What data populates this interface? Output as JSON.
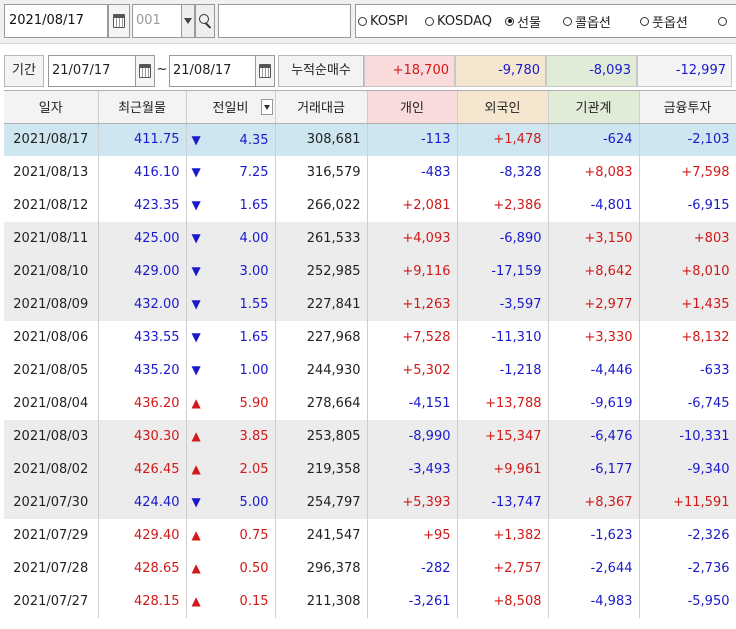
{
  "toolbar": {
    "date": "2021/08/17",
    "code": "001",
    "name": "",
    "markets": [
      {
        "label": "KOSPI",
        "selected": false
      },
      {
        "label": "KOSDAQ",
        "selected": false
      },
      {
        "label": "선물",
        "selected": true
      },
      {
        "label": "콜옵션",
        "selected": false
      },
      {
        "label": "풋옵션",
        "selected": false
      },
      {
        "label": "",
        "selected": false
      }
    ]
  },
  "period": {
    "label": "기간",
    "from": "21/07/17",
    "tilde": "~",
    "to": "21/08/17",
    "cum_label": "누적순매수",
    "cum_values": [
      {
        "key": "individual",
        "value": "+18,700",
        "color": "#d11919",
        "bg": "#fadbdb"
      },
      {
        "key": "foreign",
        "value": "-9,780",
        "color": "#1a1acc",
        "bg": "#f5e6d0"
      },
      {
        "key": "institution",
        "value": "-8,093",
        "color": "#1a1acc",
        "bg": "#e1ecd6"
      },
      {
        "key": "financial",
        "value": "-12,997",
        "color": "#1a1acc",
        "bg": "#f3f3f3"
      }
    ]
  },
  "table": {
    "headers": {
      "date": "일자",
      "recent": "최근월물",
      "change": "전일비",
      "volume": "거래대금",
      "individual": "개인",
      "foreign": "외국인",
      "institution": "기관계",
      "financial": "금융투자"
    },
    "rows": [
      {
        "date": "2021/08/17",
        "price": "411.75",
        "dir": "down",
        "chg": "4.35",
        "vol": "308,681",
        "ind": "-113",
        "for": "+1,478",
        "inst": "-624",
        "fin": "-2,103"
      },
      {
        "date": "2021/08/13",
        "price": "416.10",
        "dir": "down",
        "chg": "7.25",
        "vol": "316,579",
        "ind": "-483",
        "for": "-8,328",
        "inst": "+8,083",
        "fin": "+7,598"
      },
      {
        "date": "2021/08/12",
        "price": "423.35",
        "dir": "down",
        "chg": "1.65",
        "vol": "266,022",
        "ind": "+2,081",
        "for": "+2,386",
        "inst": "-4,801",
        "fin": "-6,915"
      },
      {
        "date": "2021/08/11",
        "price": "425.00",
        "dir": "down",
        "chg": "4.00",
        "vol": "261,533",
        "ind": "+4,093",
        "for": "-6,890",
        "inst": "+3,150",
        "fin": "+803"
      },
      {
        "date": "2021/08/10",
        "price": "429.00",
        "dir": "down",
        "chg": "3.00",
        "vol": "252,985",
        "ind": "+9,116",
        "for": "-17,159",
        "inst": "+8,642",
        "fin": "+8,010"
      },
      {
        "date": "2021/08/09",
        "price": "432.00",
        "dir": "down",
        "chg": "1.55",
        "vol": "227,841",
        "ind": "+1,263",
        "for": "-3,597",
        "inst": "+2,977",
        "fin": "+1,435"
      },
      {
        "date": "2021/08/06",
        "price": "433.55",
        "dir": "down",
        "chg": "1.65",
        "vol": "227,968",
        "ind": "+7,528",
        "for": "-11,310",
        "inst": "+3,330",
        "fin": "+8,132"
      },
      {
        "date": "2021/08/05",
        "price": "435.20",
        "dir": "down",
        "chg": "1.00",
        "vol": "244,930",
        "ind": "+5,302",
        "for": "-1,218",
        "inst": "-4,446",
        "fin": "-633"
      },
      {
        "date": "2021/08/04",
        "price": "436.20",
        "dir": "up",
        "chg": "5.90",
        "vol": "278,664",
        "ind": "-4,151",
        "for": "+13,788",
        "inst": "-9,619",
        "fin": "-6,745"
      },
      {
        "date": "2021/08/03",
        "price": "430.30",
        "dir": "up",
        "chg": "3.85",
        "vol": "253,805",
        "ind": "-8,990",
        "for": "+15,347",
        "inst": "-6,476",
        "fin": "-10,331"
      },
      {
        "date": "2021/08/02",
        "price": "426.45",
        "dir": "up",
        "chg": "2.05",
        "vol": "219,358",
        "ind": "-3,493",
        "for": "+9,961",
        "inst": "-6,177",
        "fin": "-9,340"
      },
      {
        "date": "2021/07/30",
        "price": "424.40",
        "dir": "down",
        "chg": "5.00",
        "vol": "254,797",
        "ind": "+5,393",
        "for": "-13,747",
        "inst": "+8,367",
        "fin": "+11,591"
      },
      {
        "date": "2021/07/29",
        "price": "429.40",
        "dir": "up",
        "chg": "0.75",
        "vol": "241,547",
        "ind": "+95",
        "for": "+1,382",
        "inst": "-1,623",
        "fin": "-2,326"
      },
      {
        "date": "2021/07/28",
        "price": "428.65",
        "dir": "up",
        "chg": "0.50",
        "vol": "296,378",
        "ind": "-282",
        "for": "+2,757",
        "inst": "-2,644",
        "fin": "-2,736"
      },
      {
        "date": "2021/07/27",
        "price": "428.15",
        "dir": "up",
        "chg": "0.15",
        "vol": "211,308",
        "ind": "-3,261",
        "for": "+8,508",
        "inst": "-4,983",
        "fin": "-5,950"
      }
    ],
    "row_styles": [
      "sel",
      "",
      "",
      "shade",
      "shade",
      "shade",
      "",
      "",
      "",
      "shade",
      "shade",
      "shade",
      "",
      "",
      ""
    ],
    "colors": {
      "positive": "#d11919",
      "negative": "#1a1acc",
      "selected_row": "#cde6f0",
      "shaded_row": "#ececec"
    }
  }
}
